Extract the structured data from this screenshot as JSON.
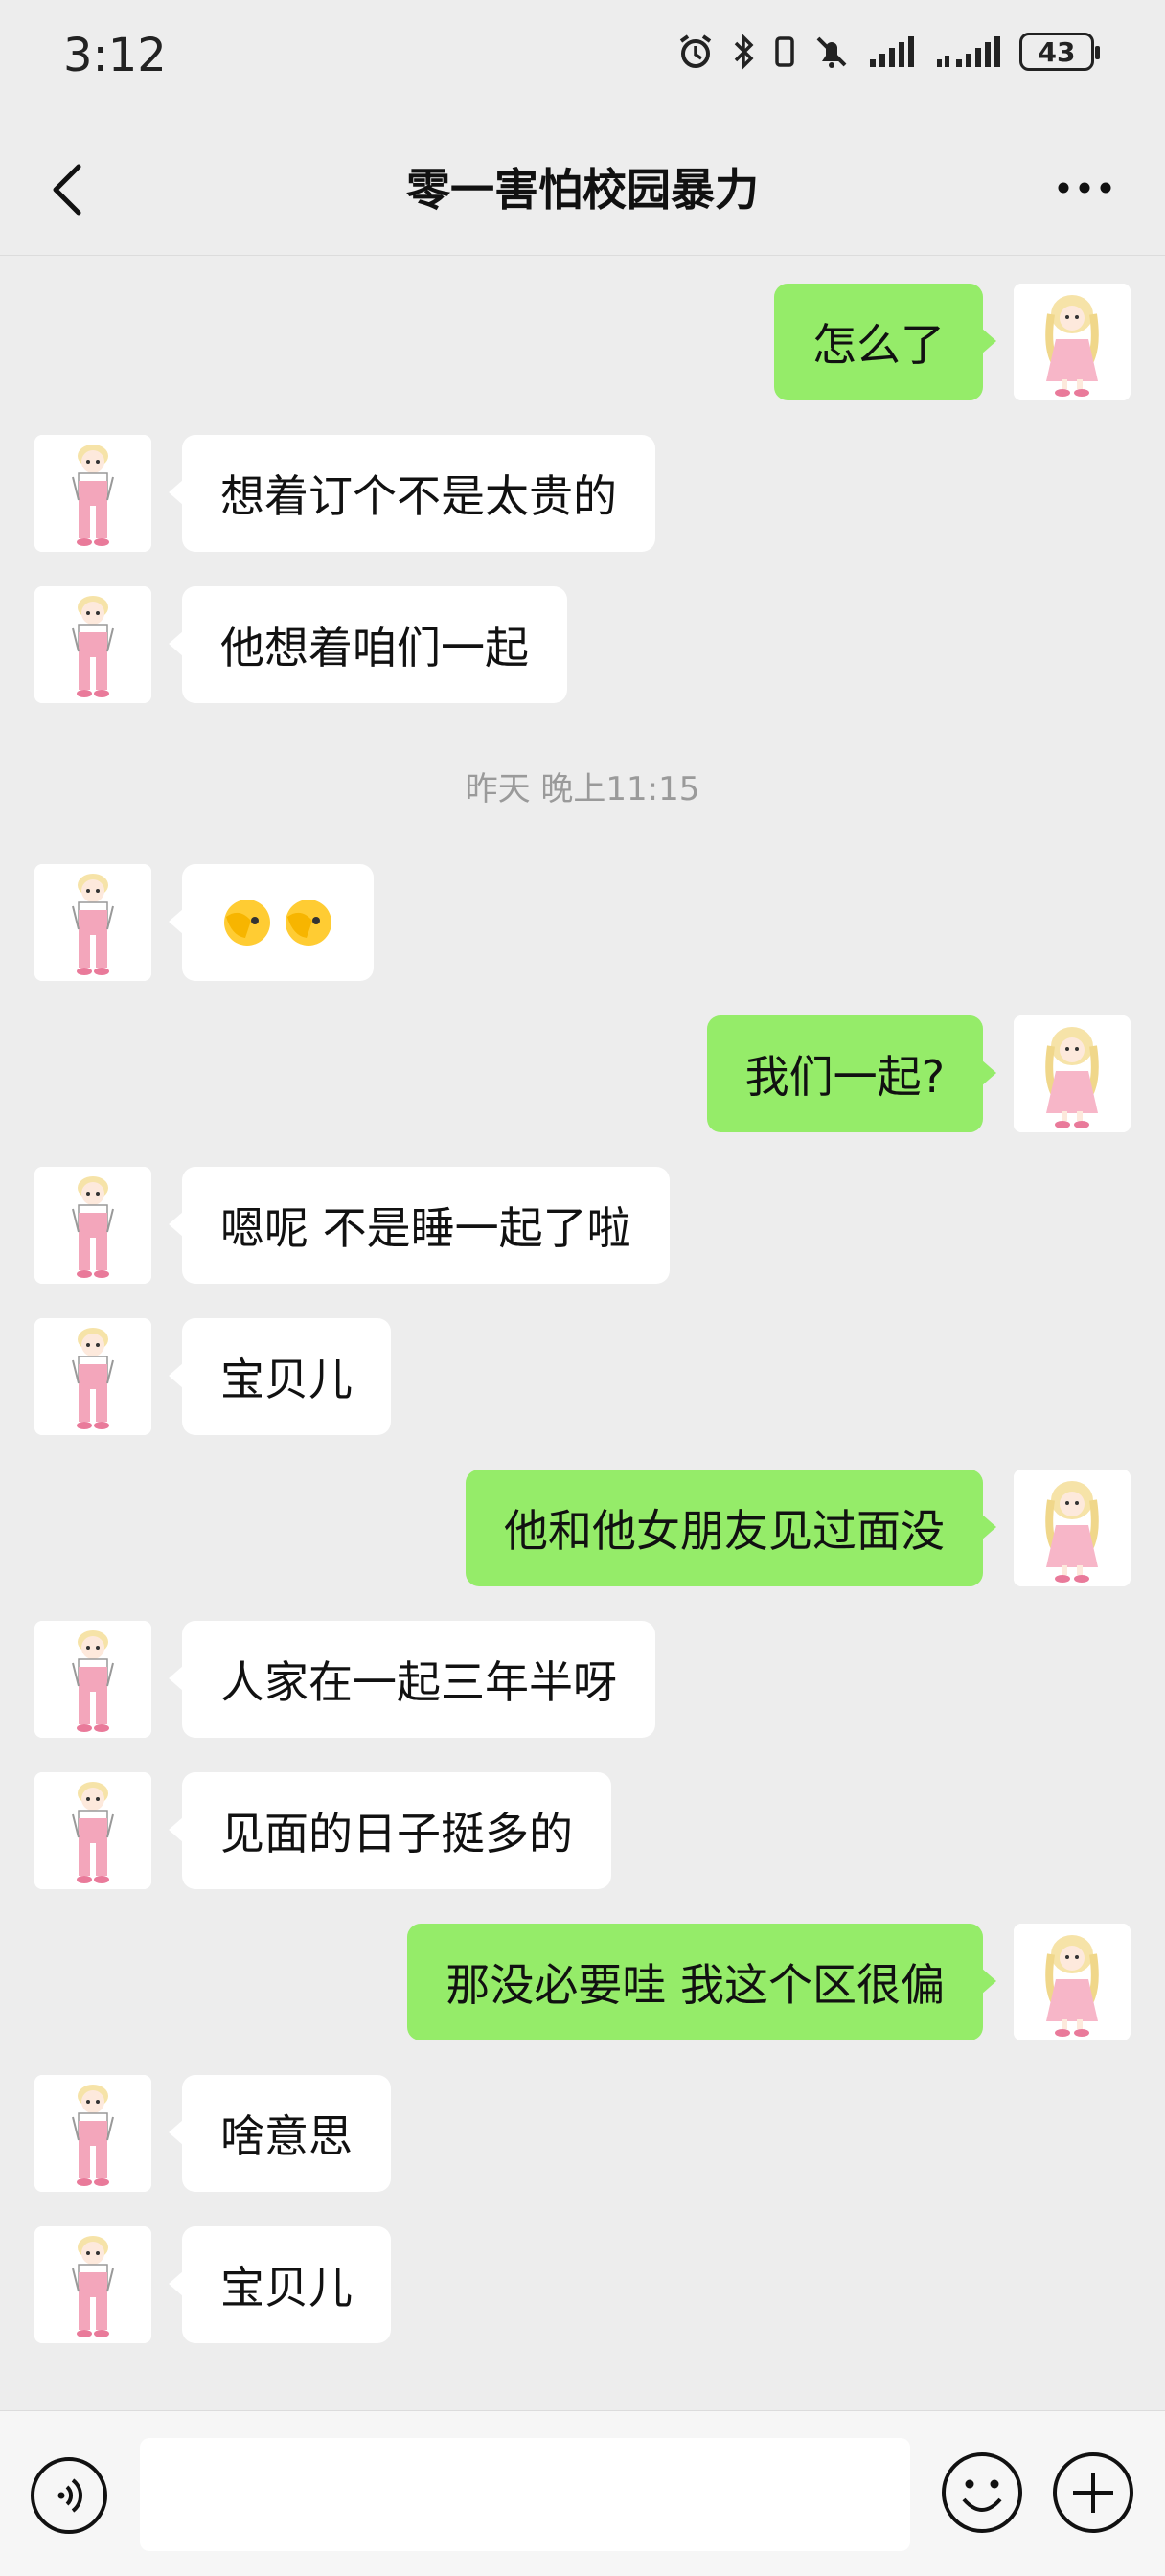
{
  "status": {
    "time": "3:12",
    "battery": "43"
  },
  "header": {
    "title": "零一害怕校园暴力"
  },
  "messages": [
    {
      "side": "out",
      "text": "怎么了"
    },
    {
      "side": "in",
      "text": "想着订个不是太贵的"
    },
    {
      "side": "in",
      "text": "他想着咱们一起"
    },
    {
      "side": "in",
      "text": ""
    },
    {
      "side": "out",
      "text": "我们一起?"
    },
    {
      "side": "in",
      "text": "嗯呢 不是睡一起了啦"
    },
    {
      "side": "in",
      "text": "宝贝儿"
    },
    {
      "side": "out",
      "text": "他和他女朋友见过面没"
    },
    {
      "side": "in",
      "text": "人家在一起三年半呀"
    },
    {
      "side": "in",
      "text": "见面的日子挺多的"
    },
    {
      "side": "out",
      "text": "那没必要哇 我这个区很偏"
    },
    {
      "side": "in",
      "text": "啥意思"
    },
    {
      "side": "in",
      "text": "宝贝儿"
    }
  ],
  "timestamp": "昨天 晚上11:15",
  "input": {
    "value": "",
    "placeholder": ""
  },
  "colors": {
    "background": "#ededed",
    "outgoing": "#95ec69",
    "incoming": "#ffffff"
  },
  "icons": [
    "back-icon",
    "more-icon",
    "voice-icon",
    "emoji-icon",
    "plus-icon",
    "alarm-icon",
    "bluetooth-icon",
    "mute-icon",
    "signal-icon"
  ]
}
